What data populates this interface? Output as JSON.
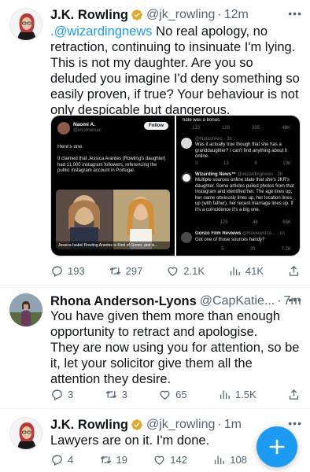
{
  "tweets": [
    {
      "name": "J.K. Rowling",
      "handle": "@jk_rowling",
      "time": "12m",
      "mention": ".@wizardingnews",
      "text": " No real apology, no retraction, continuing to insinuate I'm lying. This is not my daughter. Are you so deluded you imagine I'd deny something so easily proven, if true? Your behaviour is not only despicable but  dangerous.",
      "media": {
        "left": {
          "author": "Naomi A.",
          "author_handle": "@imomwisac",
          "follow_label": "Follow",
          "line1": "Here's one.",
          "line2": "It claimed that Jessica Arantes (Rowling's daughter) had 11,000 instagram followers, referencing the public instagram account in Portugal.",
          "caption": "Jessica Isabel Rowling Arantes is Kind of Green, and is..."
        },
        "right": {
          "top_text": "hate was a bonus.",
          "row1": [
            "133",
            "128",
            "335",
            "48K"
          ],
          "reply1_handle": "@Natashrwo · 3h",
          "reply1_text": "Was it actually true though that she has a granddaughter? I can't find anything about it online.",
          "row2": [
            "3",
            "13",
            "8",
            "19K"
          ],
          "wn_name": "Wizarding News™",
          "wn_handle": "@wizardingnews · 3h",
          "wn_text": "Multiple sources online state that she's JKR's daughter. Some articles pulled photos from that Instagram and identified her. The age lines up, her name obviously lines up, her location lines up (with father), her recent marriage lines up. If it's a coincidence it's a big one.",
          "row3": [
            "128",
            "46",
            "65K"
          ],
          "gf_name": "Gonzo Film Reviews",
          "gf_handle": "@ReviewsGo... · 1h",
          "gf_text": "Got one of those sources handy?",
          "row4": [
            "5",
            "20",
            "7.2K"
          ]
        }
      },
      "actions": {
        "replies": "193",
        "retweets": "297",
        "likes": "2.1K",
        "views": "41K"
      }
    },
    {
      "name": "Rhona Anderson-Lyons",
      "handle": "@CapKatie...",
      "time": "7m",
      "para1": "You have given them more than enough opportunity to retract and apologise.",
      "para2": "They are now using you for attention, so be it, let your solicitor give them all the attention they desire.",
      "actions": {
        "replies": "3",
        "retweets": "3",
        "likes": "65",
        "views": "1.5K"
      }
    },
    {
      "name": "J.K. Rowling",
      "handle": "@jk_rowling",
      "time": "1m",
      "text": "Lawyers are on it. I'm done.",
      "actions": {
        "replies": "4",
        "retweets": "19",
        "likes": "142",
        "views": "108"
      }
    }
  ],
  "separator": "·",
  "colors": {
    "accent": "#1d9bf0",
    "text": "#0f1419",
    "secondary": "#536471",
    "verified_gold": "#e0a82e"
  },
  "icons": [
    "verified-badge-icon",
    "more-icon",
    "reply-icon",
    "retweet-icon",
    "like-icon",
    "views-icon",
    "share-icon",
    "compose-icon"
  ]
}
